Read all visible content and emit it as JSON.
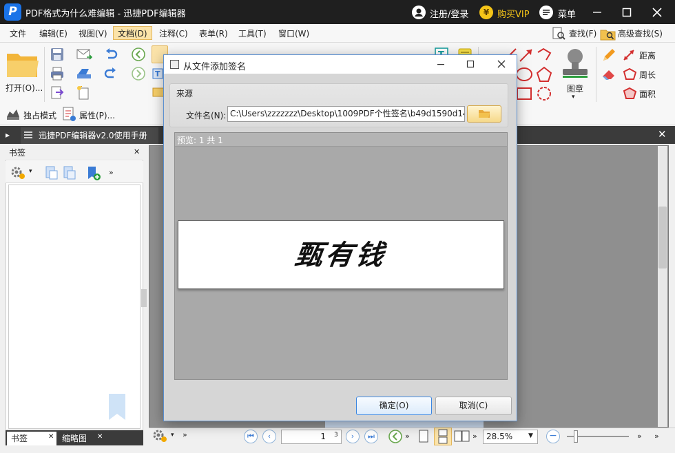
{
  "app": {
    "logo": "P",
    "title": "PDF格式为什么难编辑 - 迅捷PDF编辑器",
    "login_label": "注册/登录",
    "vip_label": "购买VIP",
    "menu_label": "菜单",
    "vip_icon": "¥"
  },
  "menubar": {
    "items": [
      "文件",
      "编辑(E)",
      "视图(V)",
      "文档(D)",
      "注释(C)",
      "表单(R)",
      "工具(T)",
      "窗口(W)"
    ],
    "active": "文档(D)",
    "search_label": "查找(F)",
    "adv_search_label": "高级查找(S)"
  },
  "ribbon": {
    "open_label": "打开(O)...",
    "solo_mode_label": "独占模式",
    "properties_label": "属性(P)...",
    "stamp_label": "图章",
    "distance_label": "距离",
    "perimeter_label": "周长",
    "area_label": "面积",
    "zoom_partial": "28.5%"
  },
  "doc_tab": {
    "title": "迅捷PDF编辑器v2.0使用手册"
  },
  "left_panel": {
    "title": "书签",
    "bottom_tabs": [
      "书签",
      "缩略图"
    ]
  },
  "status": {
    "page_input": "1",
    "page_total": "3",
    "zoom": "28.5%"
  },
  "dialog": {
    "title": "从文件添加签名",
    "source_label": "来源",
    "file_label": "文件名(N):",
    "file_path": "C:\\Users\\zzzzzzz\\Desktop\\1009PDF个性签名\\b49d1590d14",
    "preview_label": "预览: 1 共 1",
    "signature_text": "甄有钱",
    "ok_label": "确定(O)",
    "cancel_label": "取消(C)"
  },
  "colors": {
    "titlebar": "#1f1f1f",
    "vip": "#f5c518",
    "accent": "#3b86e0",
    "active_menu": "#fbe3a9"
  }
}
